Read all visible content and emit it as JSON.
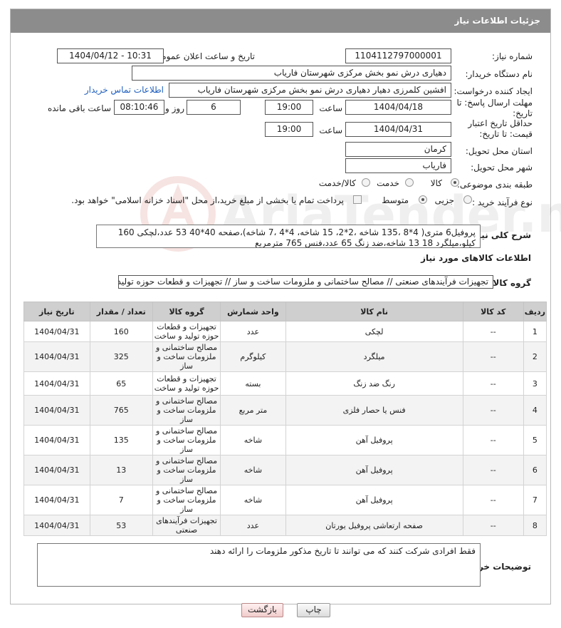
{
  "header": {
    "title": "جزئیات اطلاعات نیاز"
  },
  "form": {
    "need_number_label": "شماره نیاز:",
    "need_number": "1104112797000001",
    "announce_label": "تاریخ و ساعت اعلان عمومی:",
    "announce_value": "1404/04/12 - 10:31",
    "buyer_org_label": "نام دستگاه خریدار:",
    "buyer_org": "دهیاری درش نمو بخش مرکزی شهرستان فاریاب",
    "creator_label": "ایجاد کننده درخواست:",
    "creator": "افشین کلمرزی دهیار دهیاری درش نمو بخش مرکزی شهرستان فاریاب",
    "contact_link": "اطلاعات تماس خریدار",
    "deadline_label": "مهلت ارسال پاسخ: تا تاریخ:",
    "deadline_date": "1404/04/18",
    "time_label": "ساعت",
    "deadline_time": "19:00",
    "days_value": "6",
    "days_label": "روز و",
    "remaining_time": "08:10:46",
    "remaining_label": "ساعت باقی مانده",
    "validity_label": "حداقل تاریخ اعتبار قیمت: تا تاریخ:",
    "validity_date": "1404/04/31",
    "validity_time_label": "ساعت",
    "validity_time": "19:00",
    "province_label": "استان محل تحویل:",
    "province": "کرمان",
    "city_label": "شهر محل تحویل:",
    "city": "فاریاب",
    "category_label": "طبقه بندی موضوعی:",
    "category_options": [
      "کالا",
      "خدمت",
      "کالا/خدمت"
    ],
    "process_label": "نوع فرآیند خرید :",
    "process_options": [
      "جزیی",
      "متوسط"
    ],
    "payment_note": "پرداخت تمام یا بخشی از مبلغ خرید،از محل \"اسناد خزانه اسلامی\" خواهد بود."
  },
  "description": {
    "label": "شرح کلی نیاز:",
    "text": "پروفیل6 متری( 4*8 ،135 شاخه ،2*2، 15 شاخه، 4*4 ،7 شاخه)،صفحه 40*40 53 عدد،لچکی 160 کیلو،میلگرد 18 13 شاخه،ضد زنگ 65 عدد،فنس 765 مترمربع"
  },
  "goods_info_title": "اطلاعات کالاهای مورد نیاز",
  "goods_group": {
    "label": "گروه کالا:",
    "value": "تجهیزات فرآیندهای صنعتی // مصالح ساختمانی و ملزومات ساخت و ساز // تجهیزات و قطعات حوزه تولید و سا"
  },
  "table": {
    "headers": [
      "ردیف",
      "کد کالا",
      "نام کالا",
      "واحد شمارش",
      "گروه کالا",
      "تعداد / مقدار",
      "تاریخ نیاز"
    ],
    "rows": [
      [
        "1",
        "--",
        "لچکی",
        "عدد",
        "تجهیزات و قطعات حوزه تولید و ساخت",
        "160",
        "1404/04/31"
      ],
      [
        "2",
        "--",
        "میلگرد",
        "کیلوگرم",
        "مصالح ساختمانی و ملزومات ساخت و ساز",
        "325",
        "1404/04/31"
      ],
      [
        "3",
        "--",
        "رنگ ضد زنگ",
        "بسته",
        "تجهیزات و قطعات حوزه تولید و ساخت",
        "65",
        "1404/04/31"
      ],
      [
        "4",
        "--",
        "فنس یا حصار فلزی",
        "متر مربع",
        "مصالح ساختمانی و ملزومات ساخت و ساز",
        "765",
        "1404/04/31"
      ],
      [
        "5",
        "--",
        "پروفیل آهن",
        "شاخه",
        "مصالح ساختمانی و ملزومات ساخت و ساز",
        "135",
        "1404/04/31"
      ],
      [
        "6",
        "--",
        "پروفیل آهن",
        "شاخه",
        "مصالح ساختمانی و ملزومات ساخت و ساز",
        "13",
        "1404/04/31"
      ],
      [
        "7",
        "--",
        "پروفیل آهن",
        "شاخه",
        "مصالح ساختمانی و ملزومات ساخت و ساز",
        "7",
        "1404/04/31"
      ],
      [
        "8",
        "--",
        "صفحه ارتعاشی پروفیل یورتان",
        "عدد",
        "تجهیزات فرآیندهای صنعتی",
        "53",
        "1404/04/31"
      ]
    ]
  },
  "buyer_notes": {
    "label": "توضیحات خریدار:",
    "text": "فقط افرادی شرکت کنند که می توانند تا تاریخ مذکور ملزومات را ارائه دهند"
  },
  "buttons": {
    "print": "چاپ",
    "back": "بازگشت"
  },
  "watermark": {
    "text": "AriaTender.neT"
  },
  "colors": {
    "titlebar": "#8c8c8c",
    "link": "#1f5fbf",
    "watermark": "#c0392b"
  }
}
